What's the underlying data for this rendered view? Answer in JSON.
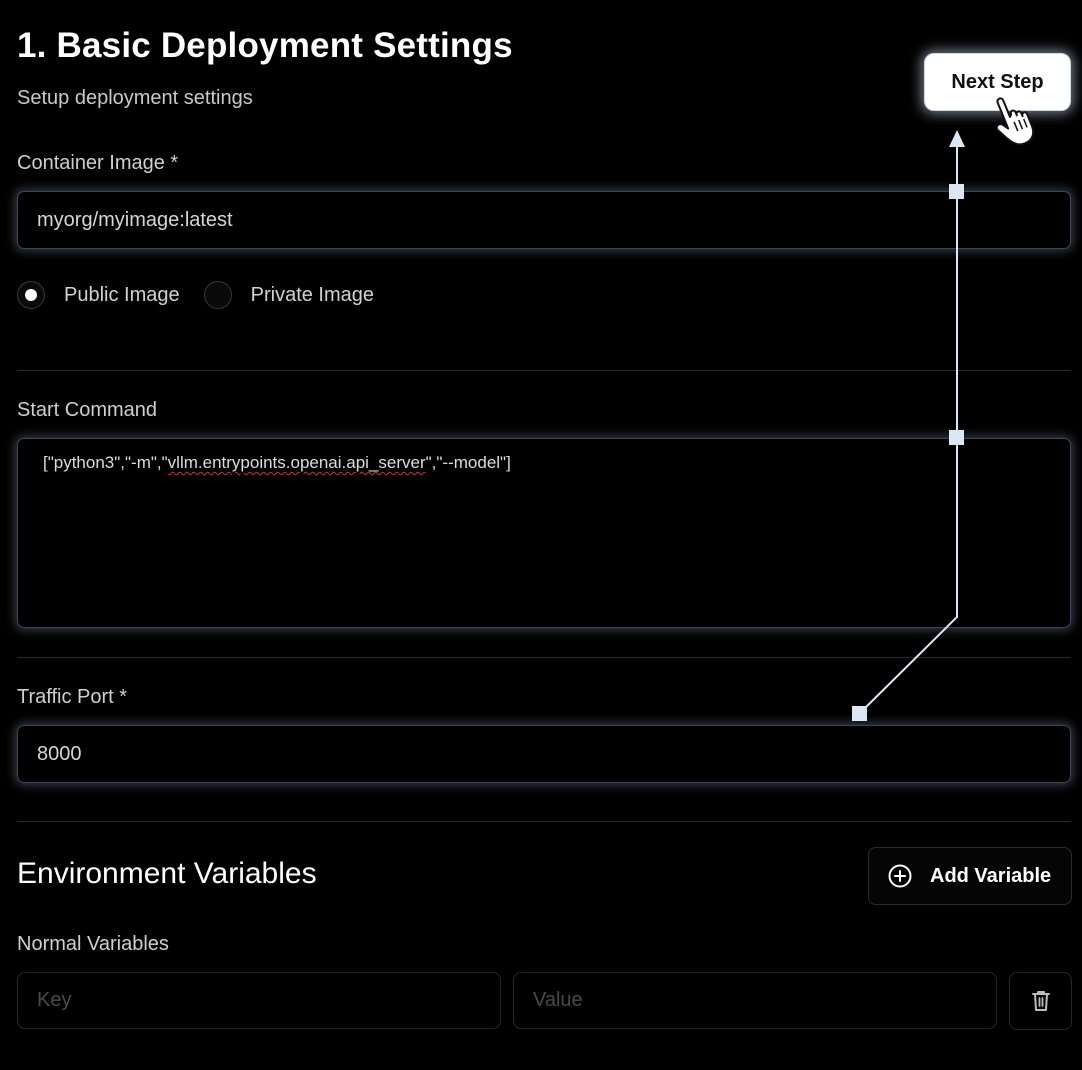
{
  "header": {
    "title": "1. Basic Deployment Settings",
    "subtitle": "Setup deployment settings",
    "next_button": "Next Step"
  },
  "container_image": {
    "label": "Container Image *",
    "value": "myorg/myimage:latest"
  },
  "image_type": {
    "options": [
      {
        "label": "Public Image",
        "selected": true
      },
      {
        "label": "Private Image",
        "selected": false
      }
    ]
  },
  "start_command": {
    "label": "Start Command",
    "value_before": "[\"python3\",\"-m\",\"",
    "value_misspelled": "vllm.entrypoints.openai.api_server",
    "value_after": "\",\"--model\"]"
  },
  "traffic_port": {
    "label": "Traffic Port *",
    "value": "8000"
  },
  "env_vars": {
    "title": "Environment Variables",
    "add_button": "Add Variable",
    "normal_label": "Normal Variables",
    "key_placeholder": "Key",
    "value_placeholder": "Value"
  },
  "icons": {
    "add": "plus-circle-icon",
    "delete": "trash-icon",
    "cursor": "hand-pointer-icon"
  },
  "colors": {
    "background": "#000000",
    "field_border": "#3d4657",
    "annotation_line": "#dce6f5",
    "spellcheck": "#d0352f"
  }
}
